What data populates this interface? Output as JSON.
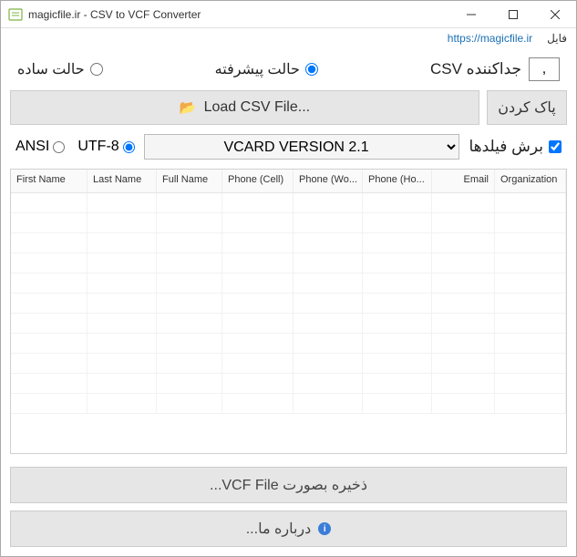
{
  "window": {
    "title": "magicfile.ir - CSV to VCF Converter"
  },
  "menubar": {
    "url": "https://magicfile.ir",
    "file_menu": "فایل"
  },
  "separator": {
    "label": "جداکننده CSV",
    "value": ","
  },
  "mode": {
    "advanced": "حالت پیشرفته",
    "simple": "حالت ساده",
    "selected": "advanced"
  },
  "buttons": {
    "clear": "پاک کردن",
    "load": "...Load CSV File",
    "save": "...VCF File ذخیره بصورت",
    "about": "...درباره ما"
  },
  "trim": {
    "label": "برش فیلدها",
    "checked": true
  },
  "version": {
    "selected": "VCARD VERSION 2.1"
  },
  "encoding": {
    "utf8": "UTF-8",
    "ansi": "ANSI",
    "selected": "utf8"
  },
  "table": {
    "columns": [
      "First Name",
      "Last Name",
      "Full Name",
      "Phone (Cell)",
      "Phone (Wo...",
      "Phone (Ho...",
      "Email",
      "Organization"
    ],
    "rows": []
  }
}
